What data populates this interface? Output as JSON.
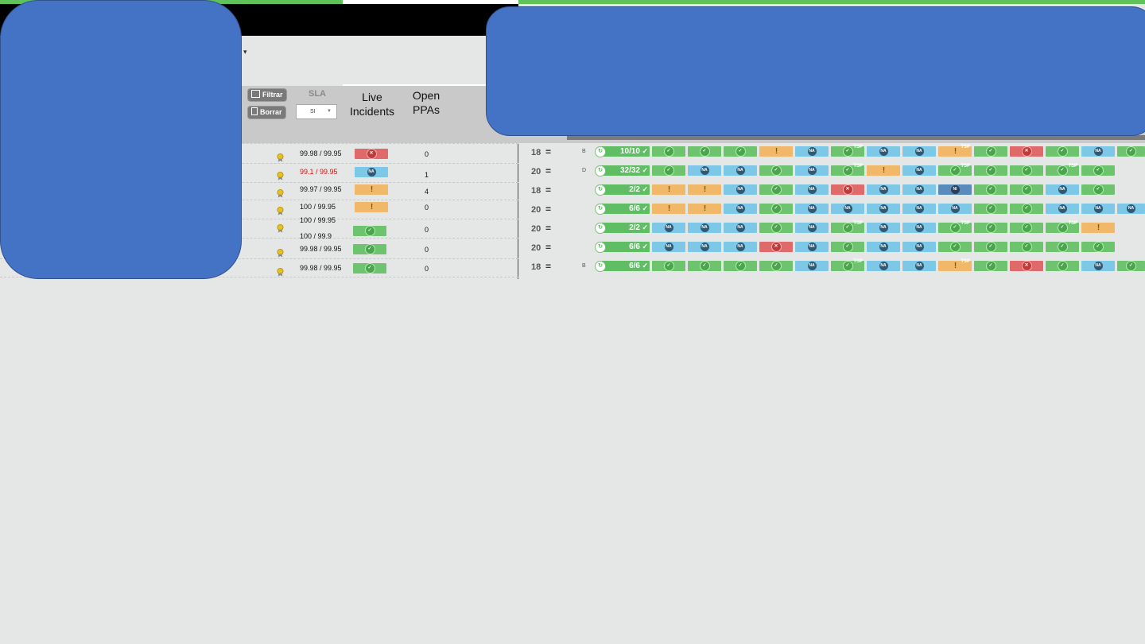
{
  "filters": {
    "filter_button": "Filtrar",
    "clear_button": "Borrar",
    "sla_label": "SLA",
    "sla_select_value": "SI"
  },
  "headers": {
    "live_incidents_line1": "Live",
    "live_incidents_line2": "Incidents",
    "open_ppas_line1": "Open",
    "open_ppas_line2": "PPAs"
  },
  "left_rows": [
    {
      "sla": "99.98 / 99.95",
      "sla_breach": false,
      "incident_status": "red",
      "open_ppas": "0"
    },
    {
      "sla": "99.1 / 99.95",
      "sla_breach": true,
      "incident_status": "na",
      "open_ppas": "1"
    },
    {
      "sla": "99.97 / 99.95",
      "sla_breach": false,
      "incident_status": "warn",
      "open_ppas": "4"
    },
    {
      "sla": "100 / 99.95",
      "sla_breach": false,
      "incident_status": "warn",
      "open_ppas": "0"
    },
    {
      "sla": "100 / 99.95",
      "sla2": "100 / 99.9",
      "sla_breach": false,
      "incident_status": "ok",
      "open_ppas": "0"
    },
    {
      "sla": "99.98 / 99.95",
      "sla_breach": false,
      "incident_status": "ok",
      "open_ppas": "0"
    },
    {
      "sla": "99.98 / 99.95",
      "sla_breach": false,
      "incident_status": "ok",
      "open_ppas": "0"
    }
  ],
  "grid_rows": [
    {
      "num": "18",
      "trend": "=",
      "letter": "B",
      "count": "10/10",
      "cells": [
        "ok",
        "ok",
        "ok",
        "warn",
        "na",
        "ok-tsp",
        "na",
        "na",
        "warn-tsp",
        "ok",
        "err",
        "ok",
        "na",
        "ok"
      ]
    },
    {
      "num": "20",
      "trend": "=",
      "letter": "D",
      "count": "32/32",
      "cells": [
        "ok",
        "na",
        "na",
        "ok",
        "na",
        "ok-tsp",
        "warn",
        "na",
        "ok-tsp",
        "ok",
        "ok",
        "ok-tsp",
        "ok"
      ]
    },
    {
      "num": "18",
      "trend": "=",
      "letter": "",
      "count": "2/2",
      "cells": [
        "warn",
        "warn",
        "na",
        "ok",
        "na",
        "err",
        "na",
        "na",
        "ni",
        "ok",
        "ok",
        "na",
        "ok"
      ]
    },
    {
      "num": "20",
      "trend": "=",
      "letter": "",
      "count": "6/6",
      "cells": [
        "warn",
        "warn",
        "na",
        "ok",
        "na",
        "na",
        "na",
        "na",
        "na",
        "ok",
        "ok",
        "na",
        "na",
        "na"
      ]
    },
    {
      "num": "20",
      "trend": "=",
      "letter": "",
      "count": "2/2",
      "cells": [
        "na",
        "na",
        "na",
        "ok",
        "na",
        "ok-tsp",
        "na",
        "na",
        "ok-tsp",
        "ok",
        "ok",
        "ok-tsp",
        "warn"
      ]
    },
    {
      "num": "20",
      "trend": "=",
      "letter": "",
      "count": "6/6",
      "cells": [
        "na",
        "na",
        "na",
        "err",
        "na",
        "ok",
        "na",
        "na",
        "ok",
        "ok",
        "ok",
        "ok",
        "ok"
      ]
    },
    {
      "num": "18",
      "trend": "=",
      "letter": "B",
      "count": "6/6",
      "cells": [
        "ok",
        "ok",
        "ok",
        "ok",
        "na",
        "ok-tsp",
        "na",
        "na",
        "warn-tsp",
        "ok",
        "err",
        "ok",
        "na",
        "ok"
      ]
    }
  ],
  "icons": {
    "ok": "✓",
    "err": "✕",
    "warn": "!",
    "na": "NA",
    "ni": "NI",
    "tsp": "TSP",
    "medal": "medal-icon"
  },
  "colors": {
    "ok": "#6ec36f",
    "na": "#7cc8e6",
    "warn": "#f0b868",
    "err": "#e06a6a",
    "ni": "#5a8bbd",
    "redaction": "#4472c4"
  }
}
